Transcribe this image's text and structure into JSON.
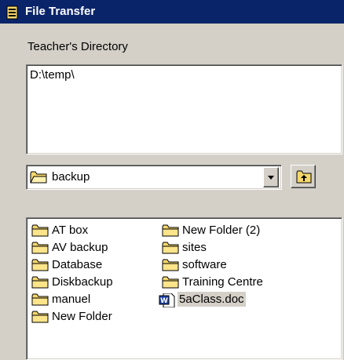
{
  "window": {
    "title": "File Transfer",
    "icon": "file-transfer-icon"
  },
  "teacher_directory": {
    "label": "Teacher's Directory",
    "path": "D:\\temp\\"
  },
  "folder_combo": {
    "selected": "backup",
    "icon": "folder-icon"
  },
  "toolbar": {
    "up_folder_icon": "up-folder-icon"
  },
  "file_list": {
    "column1": [
      "AT box",
      "AV backup",
      "Database",
      "Diskbackup",
      "manuel",
      "New Folder"
    ],
    "column2": [
      "New Folder (2)",
      "sites",
      "software",
      "Training Centre"
    ],
    "document": "5aClass.doc",
    "document_icon": "word-document-icon",
    "selected_item": "5aClass.doc"
  },
  "colors": {
    "titlebar": "#0a246a",
    "window_bg": "#d4d0c8",
    "folder": "#f4d66c"
  }
}
